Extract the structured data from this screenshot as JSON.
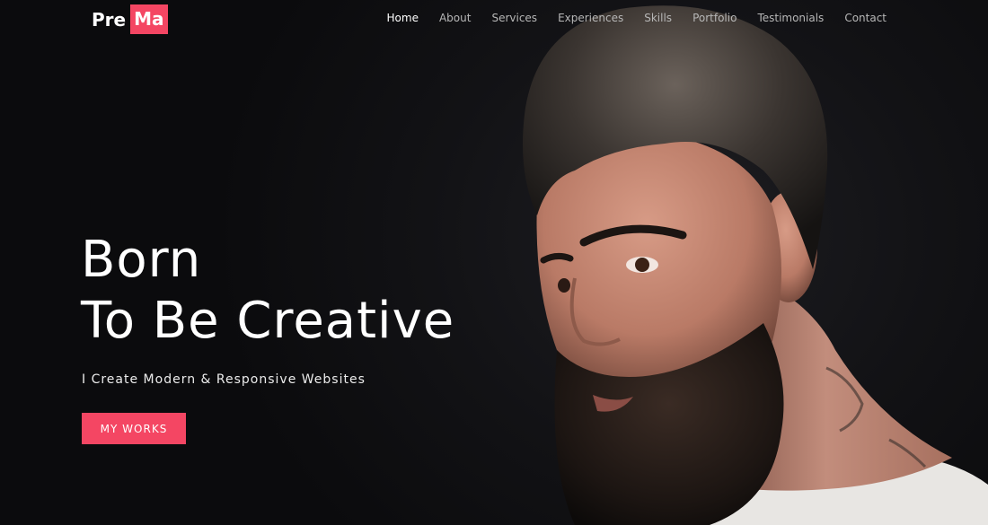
{
  "logo": {
    "part1": "Pre",
    "part2": "Ma"
  },
  "nav": {
    "items": [
      {
        "label": "Home",
        "active": true
      },
      {
        "label": "About",
        "active": false
      },
      {
        "label": "Services",
        "active": false
      },
      {
        "label": "Experiences",
        "active": false
      },
      {
        "label": "Skills",
        "active": false
      },
      {
        "label": "Portfolio",
        "active": false
      },
      {
        "label": "Testimonials",
        "active": false
      },
      {
        "label": "Contact",
        "active": false
      }
    ]
  },
  "hero": {
    "title_line1": "Born",
    "title_line2": "To Be Creative",
    "subtitle": "I Create Modern & Responsive Websites",
    "cta_label": "MY WORKS"
  },
  "colors": {
    "accent": "#f44663",
    "background": "#0d0d0f",
    "text": "#ffffff"
  }
}
